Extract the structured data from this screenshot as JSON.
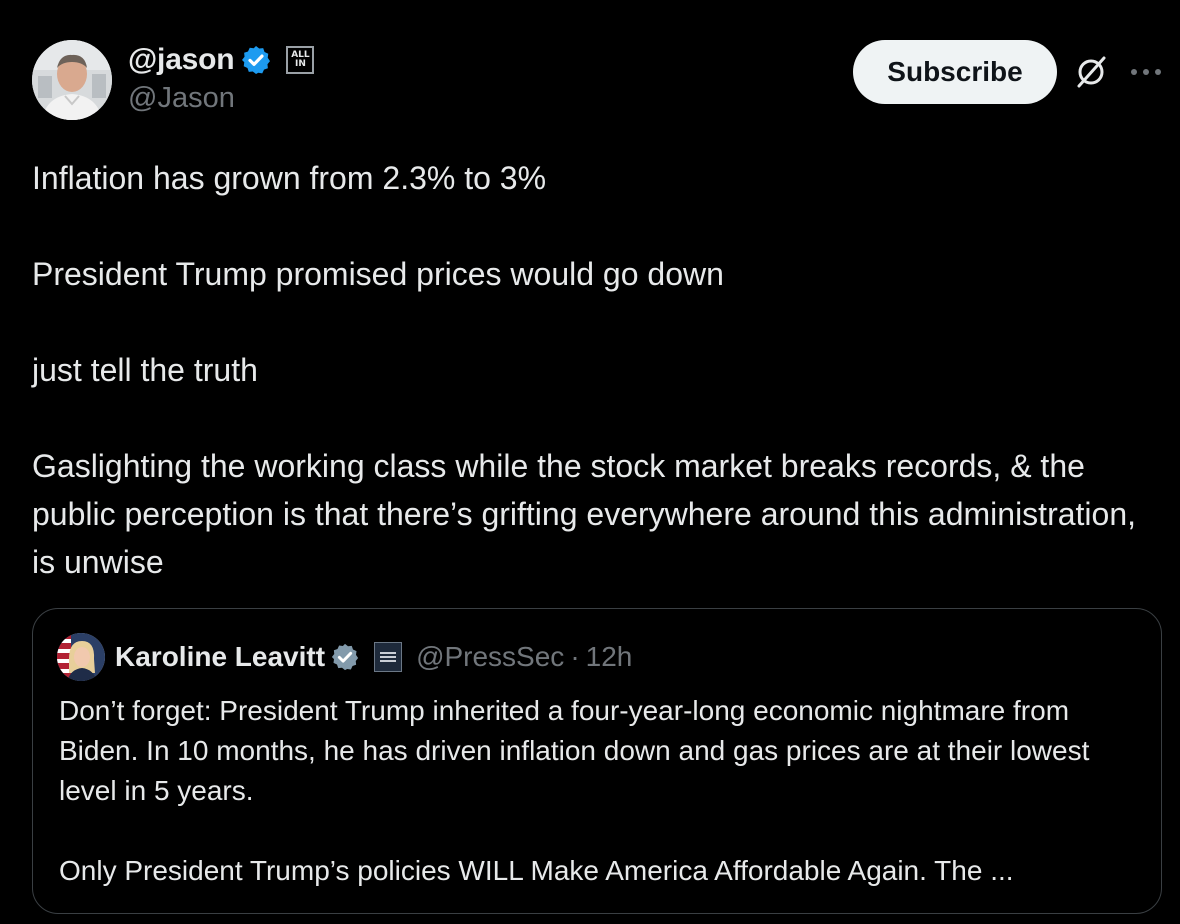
{
  "author": {
    "display_name": "@jason",
    "handle": "@Jason",
    "verified_icon": "verified-badge-icon",
    "affiliation_badge": {
      "line1": "ALL",
      "line2": "IN"
    }
  },
  "actions": {
    "subscribe_label": "Subscribe",
    "grok_icon": "grok-icon",
    "more_icon": "more-options-icon"
  },
  "post": {
    "paragraphs": [
      "Inflation has grown from 2.3% to 3%",
      "President Trump promised prices would go down",
      "just tell the truth",
      "Gaslighting the working class while the stock market breaks records, & the public perception is that there’s grifting everywhere around this administration, is unwise"
    ]
  },
  "quote": {
    "display_name": "Karoline Leavitt",
    "handle": "@PressSec",
    "separator": "·",
    "time": "12h",
    "verified_icon": "verified-gray-badge-icon",
    "affiliation_icon": "white-house-badge-icon",
    "paragraphs": [
      "Don’t forget: President Trump inherited a four-year-long economic nightmare from Biden. In 10 months, he has driven inflation down and gas prices are at their lowest level in 5 years.",
      "Only President Trump’s policies WILL Make America Affordable Again. The ..."
    ]
  },
  "colors": {
    "background": "#000000",
    "text_primary": "#e7e9ea",
    "text_secondary": "#71767b",
    "verified_blue": "#1d9bf0",
    "verified_gray": "#829aab",
    "button_bg": "#eff3f4",
    "border": "#3a3f43"
  }
}
